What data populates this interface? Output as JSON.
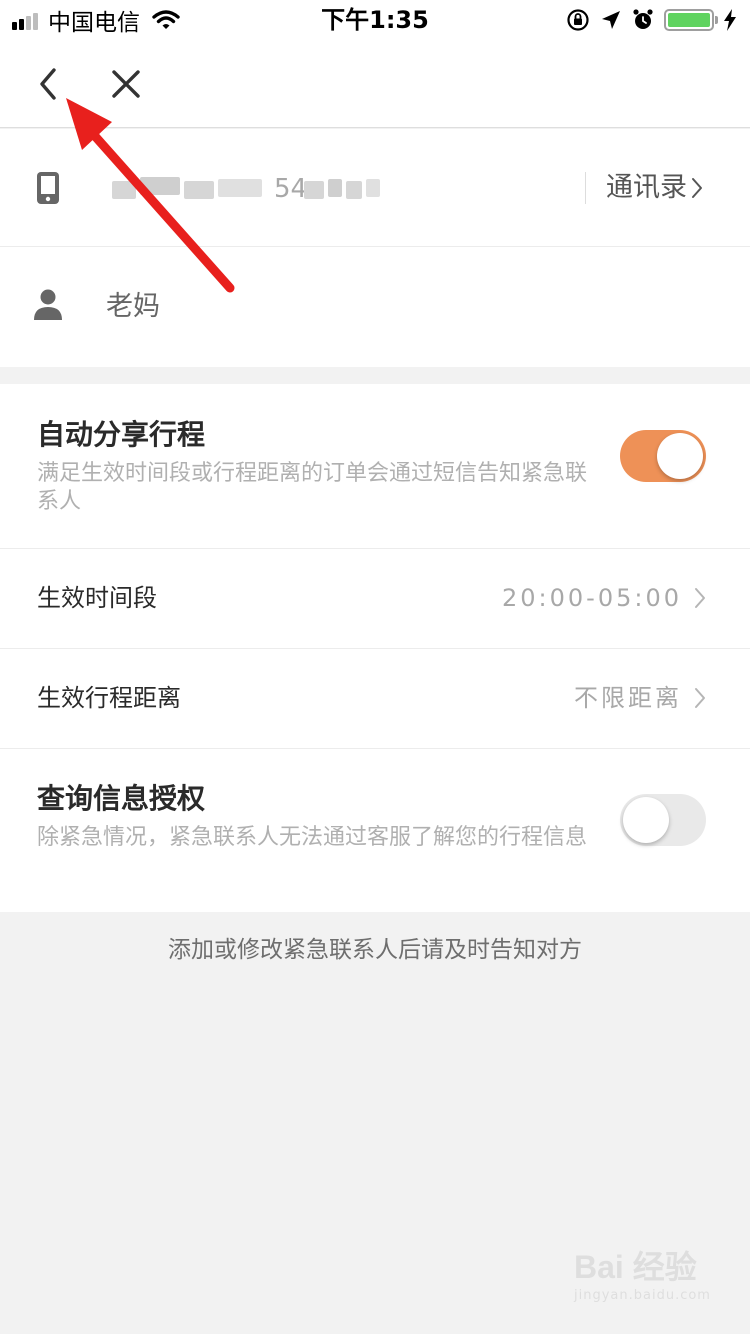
{
  "status_bar": {
    "carrier": "中国电信",
    "time": "下午1:35",
    "battery_level": 1.0
  },
  "nav": {
    "back_icon": "chevron-left-icon",
    "close_icon": "close-icon"
  },
  "contact": {
    "phone_visible_digits": "54",
    "contacts_link": "通讯录",
    "name": "老妈"
  },
  "settings": {
    "auto_share": {
      "title": "自动分享行程",
      "description": "满足生效时间段或行程距离的订单会通过短信告知紧急联系人",
      "enabled": true
    },
    "effective_time": {
      "label": "生效时间段",
      "value": "20:00-05:00"
    },
    "effective_distance": {
      "label": "生效行程距离",
      "value": "不限距离"
    },
    "query_auth": {
      "title": "查询信息授权",
      "description": "除紧急情况，紧急联系人无法通过客服了解您的行程信息",
      "enabled": false
    }
  },
  "footer_note": "添加或修改紧急联系人后请及时告知对方",
  "watermark": {
    "text": "Bai 经验",
    "sub": "jingyan.baidu.com"
  },
  "colors": {
    "toggle_on": "#ee9157",
    "toggle_off": "#e9e9e9",
    "annotation_arrow": "#e8201d",
    "battery": "#5fd35f"
  }
}
